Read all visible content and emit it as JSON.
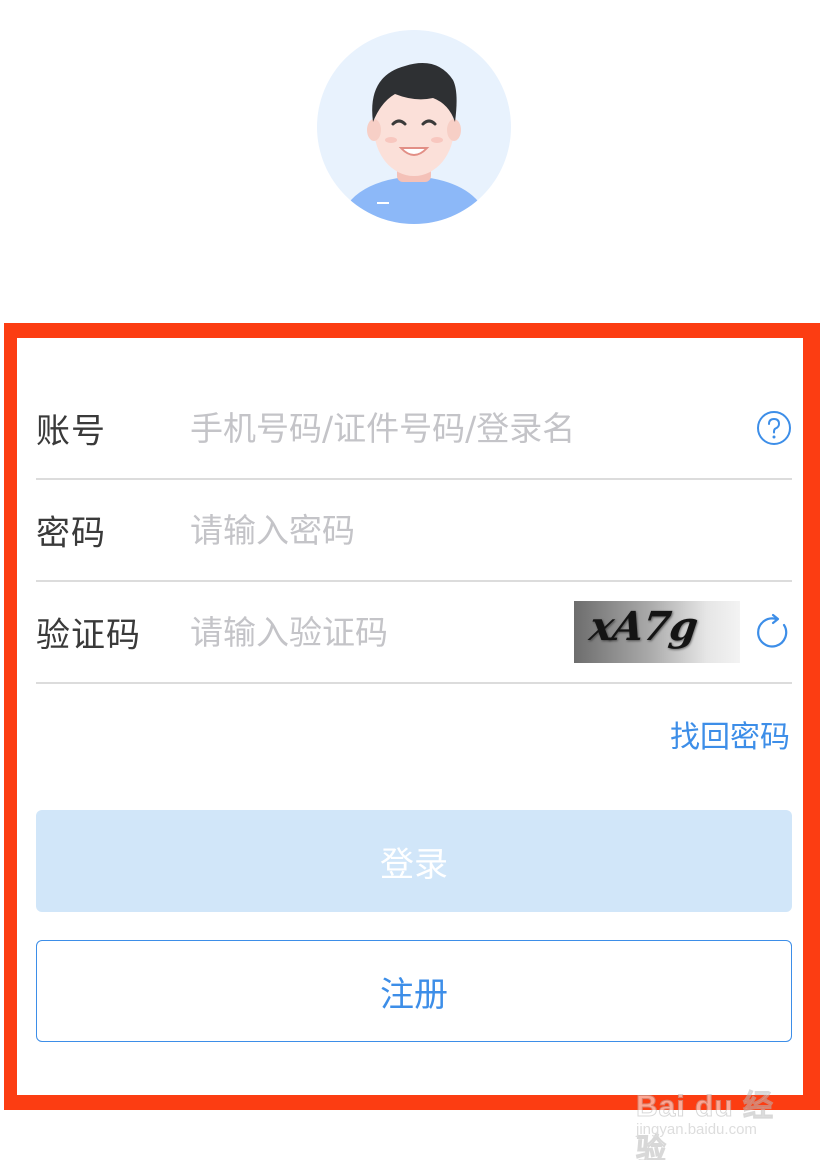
{
  "form": {
    "account": {
      "label": "账号",
      "placeholder": "手机号码/证件号码/登录名",
      "help_icon": "question-circle-icon"
    },
    "password": {
      "label": "密码",
      "placeholder": "请输入密码"
    },
    "captcha": {
      "label": "验证码",
      "placeholder": "请输入验证码",
      "image_text": "xA7g",
      "refresh_icon": "refresh-icon"
    },
    "forgot_password": "找回密码",
    "login_button": "登录",
    "register_button": "注册"
  },
  "avatar": {
    "icon": "user-avatar-icon"
  },
  "watermark": {
    "brand": "Bai du 经验",
    "url": "jingyan.baidu.com"
  },
  "colors": {
    "accent": "#3d8ee8",
    "login_disabled_bg": "#d1e6f9",
    "highlight_border": "#fc3d12",
    "avatar_bg": "#e8f2fd"
  }
}
